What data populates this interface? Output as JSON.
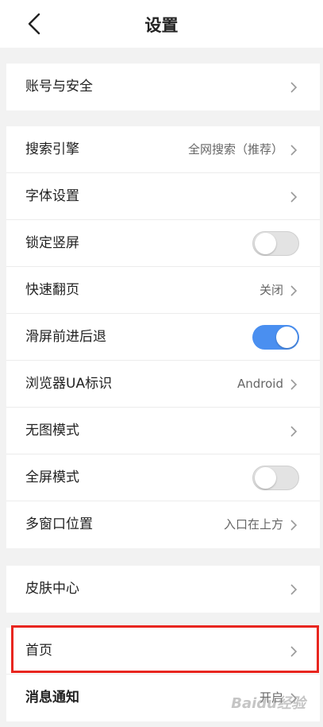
{
  "header": {
    "title": "设置",
    "back_icon": "chevron-left-icon"
  },
  "group1": [
    {
      "label": "账号与安全"
    }
  ],
  "group2": [
    {
      "label": "搜索引擎",
      "value": "全网搜索（推荐）"
    },
    {
      "label": "字体设置"
    },
    {
      "label": "锁定竖屏",
      "toggle": "off"
    },
    {
      "label": "快速翻页",
      "value": "关闭"
    },
    {
      "label": "滑屏前进后退",
      "toggle": "on"
    },
    {
      "label": "浏览器UA标识",
      "value": "Android"
    },
    {
      "label": "无图模式"
    },
    {
      "label": "全屏模式",
      "toggle": "off"
    },
    {
      "label": "多窗口位置",
      "value": "入口在上方"
    }
  ],
  "group3": [
    {
      "label": "皮肤中心"
    }
  ],
  "group4": [
    {
      "label": "首页"
    },
    {
      "label": "消息通知",
      "value": "开启"
    }
  ],
  "colors": {
    "toggle_on": "#4a8ff0",
    "highlight": "#e8261f"
  },
  "watermark": "Baidu经验"
}
